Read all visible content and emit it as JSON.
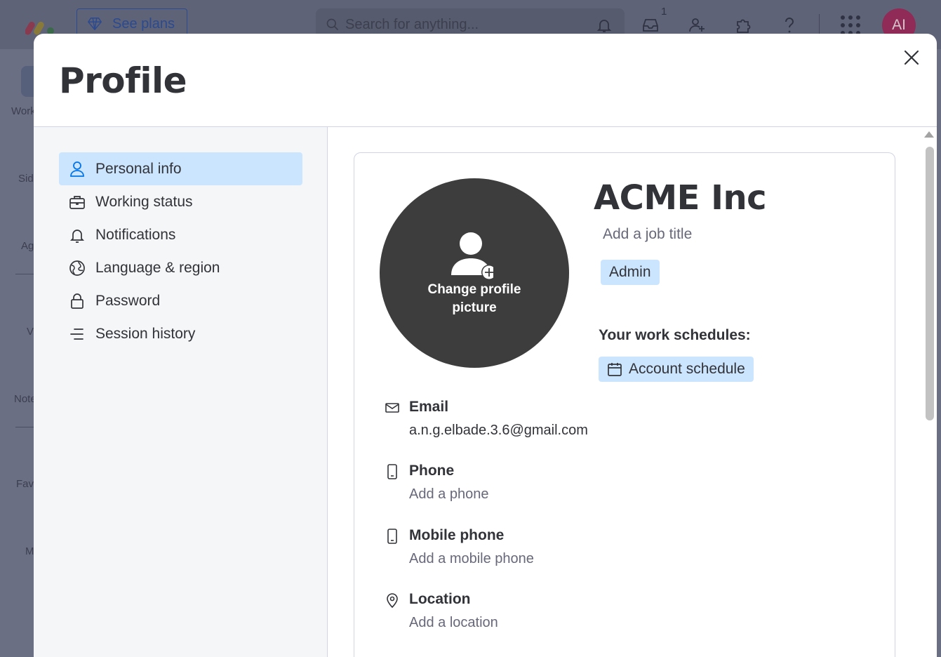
{
  "topbar": {
    "see_plans": "See plans",
    "search_placeholder": "Search for anything...",
    "inbox_count": "1",
    "avatar_initials": "AI"
  },
  "bg_sidebar": {
    "labels": [
      "Work",
      "Sid",
      "Ag",
      "V",
      "Note",
      "Fav",
      "M"
    ]
  },
  "modal": {
    "title": "Profile"
  },
  "nav": {
    "items": [
      {
        "label": "Personal info",
        "icon": "person-icon",
        "active": true
      },
      {
        "label": "Working status",
        "icon": "briefcase-icon",
        "active": false
      },
      {
        "label": "Notifications",
        "icon": "bell-icon",
        "active": false
      },
      {
        "label": "Language & region",
        "icon": "globe-icon",
        "active": false
      },
      {
        "label": "Password",
        "icon": "lock-icon",
        "active": false
      },
      {
        "label": "Session history",
        "icon": "list-icon",
        "active": false
      }
    ]
  },
  "profile": {
    "change_picture_line1": "Change profile",
    "change_picture_line2": "picture",
    "name": "ACME Inc",
    "job_title_placeholder": "Add a job title",
    "role_badge": "Admin",
    "work_schedules_label": "Your work schedules:",
    "schedule_chip": "Account schedule",
    "fields": [
      {
        "label": "Email",
        "value": "a.n.g.elbade.3.6@gmail.com",
        "placeholder": false,
        "icon": "mail-icon"
      },
      {
        "label": "Phone",
        "value": "Add a phone",
        "placeholder": true,
        "icon": "phone-icon"
      },
      {
        "label": "Mobile phone",
        "value": "Add a mobile phone",
        "placeholder": true,
        "icon": "mobile-icon"
      },
      {
        "label": "Location",
        "value": "Add a location",
        "placeholder": true,
        "icon": "location-icon"
      }
    ]
  },
  "colors": {
    "accent": "#0073ea",
    "active_bg": "#cce5ff",
    "avatar_bg": "#3d3d3d",
    "overlay": "#6b6f83"
  }
}
